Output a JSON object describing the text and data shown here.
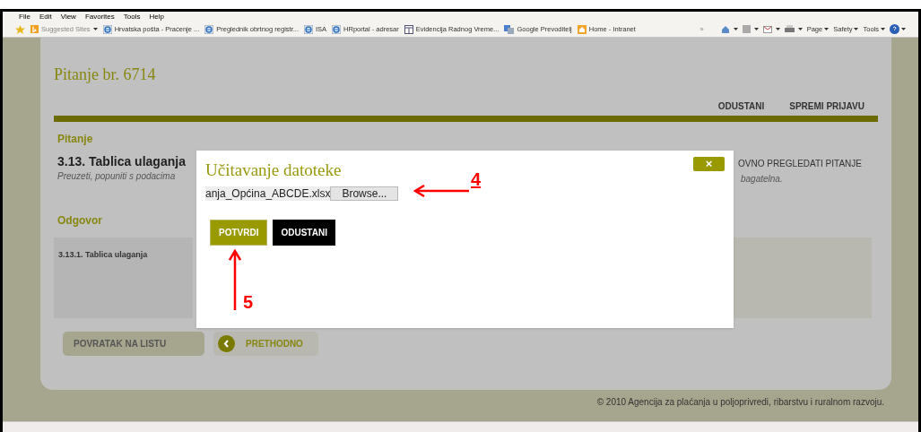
{
  "browser": {
    "menu": [
      "File",
      "Edit",
      "View",
      "Favorites",
      "Tools",
      "Help"
    ],
    "favorites": [
      {
        "kind": "star"
      },
      {
        "kind": "suggested",
        "label": "Suggested Sites"
      },
      {
        "kind": "ie",
        "label": "Hrvatska pošta - Praćenje ..."
      },
      {
        "kind": "ie",
        "label": "Preglednik obrtnog registr..."
      },
      {
        "kind": "ie",
        "label": "ISA"
      },
      {
        "kind": "ie",
        "label": "HRportal - adresar"
      },
      {
        "kind": "sheet",
        "label": "Evidencija Radnog Vreme..."
      },
      {
        "kind": "translate",
        "label": "Google Prevoditelj"
      },
      {
        "kind": "home",
        "label": "Home - Intranet"
      }
    ],
    "overflow": "»",
    "commands": [
      "Page",
      "Safety",
      "Tools"
    ]
  },
  "page": {
    "title": "Pitanje br. 6714",
    "header_links": [
      "ODUSTANI",
      "SPREMI PRIJAVU"
    ],
    "question_heading": "Pitanje",
    "question_title": "3.13. Tablica ulaganja",
    "question_text": "Preuzeti, popuniti s podacima",
    "review_link": "OVNO PREGLEDATI PITANJE",
    "question_text_end": "bagatelna.",
    "answer_heading": "Odgovor",
    "answer_item": "3.13.1. Tablica ulaganja",
    "nav_buttons": [
      {
        "kind": "plain",
        "label": "POVRATAK NA LISTU"
      },
      {
        "kind": "back",
        "label": "PRETHODNO"
      }
    ],
    "footer": "© 2010 Agencija za plaćanja u poljoprivredi, ribarstvu i ruralnom razvoju."
  },
  "dialog": {
    "title": "Učitavanje datoteke",
    "close": "×",
    "file_value": "anja_Općina_ABCDE.xlsx",
    "browse": "Browse...",
    "buttons": [
      {
        "kind": "primary",
        "label": "POTVRDI"
      },
      {
        "kind": "dark",
        "label": "ODUSTANI"
      }
    ]
  },
  "annotations": [
    {
      "kind": "left",
      "label": "4"
    },
    {
      "kind": "up",
      "label": "5"
    }
  ]
}
